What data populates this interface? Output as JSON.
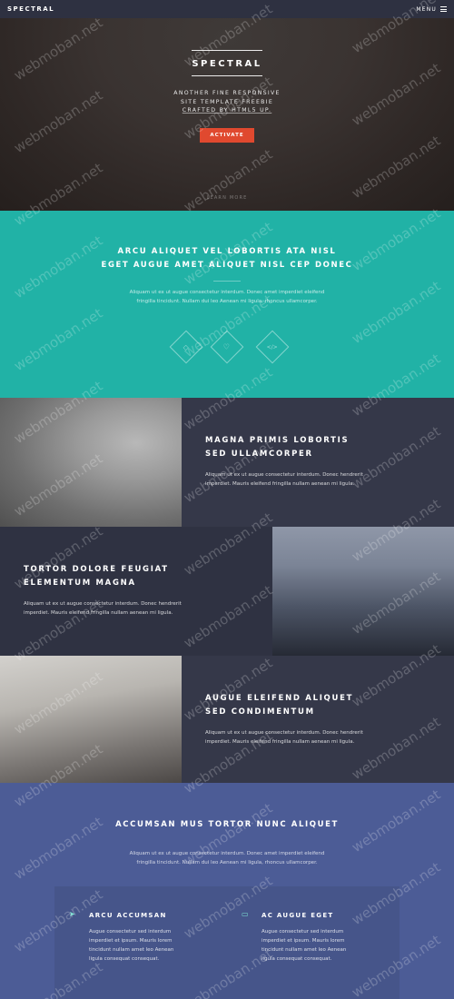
{
  "nav": {
    "logo": "SPECTRAL",
    "menu_label": "MENU",
    "menu_icon": "hamburger-icon"
  },
  "hero": {
    "title": "SPECTRAL",
    "subtitle_lines": [
      "ANOTHER FINE RESPONSIVE",
      "SITE TEMPLATE FREEBIE",
      "CRAFTED BY HTML5 UP."
    ],
    "button": "ACTIVATE",
    "learn_more": "LEARN MORE"
  },
  "intro": {
    "heading_lines": [
      "ARCU ALIQUET VEL LOBORTIS ATA NISL",
      "EGET AUGUE AMET ALIQUET NISL CEP DONEC"
    ],
    "text_lines": [
      "Aliquam ut ex ut augue consectetur interdum. Donec amet imperdiet eleifend",
      "fringilla tincidunt. Nullam dui leo Aenean mi ligula, rhoncus ullamcorper."
    ],
    "icons": [
      "diamond-icon",
      "heart-icon",
      "code-icon"
    ],
    "icon_glyphs": [
      "◇",
      "♡",
      "</>"
    ]
  },
  "spotlights": [
    {
      "heading_lines": [
        "MAGNA PRIMIS LOBORTIS",
        "SED ULLAMCORPER"
      ],
      "text_lines": [
        "Aliquam ut ex ut augue consectetur interdum. Donec hendrerit",
        "imperdiet. Mauris eleifend fringilla nullam aenean mi ligula."
      ]
    },
    {
      "heading_lines": [
        "TORTOR DOLORE FEUGIAT",
        "ELEMENTUM MAGNA"
      ],
      "text_lines": [
        "Aliquam ut ex ut augue consectetur interdum. Donec hendrerit",
        "imperdiet. Mauris eleifend fringilla nullam aenean mi ligula."
      ]
    },
    {
      "heading_lines": [
        "AUGUE ELEIFEND ALIQUET",
        "SED CONDIMENTUM"
      ],
      "text_lines": [
        "Aliquam ut ex ut augue consectetur interdum. Donec hendrerit",
        "imperdiet. Mauris eleifend fringilla nullam aenean mi ligula."
      ]
    }
  ],
  "features": {
    "heading": "ACCUMSAN MUS TORTOR NUNC ALIQUET",
    "text_lines": [
      "Aliquam ut ex ut augue consectetur interdum. Donec amet imperdiet eleifend",
      "fringilla tincidunt. Nullam dui leo Aenean mi ligula, rhoncus ullamcorper."
    ],
    "cards": [
      {
        "icon": "paper-plane-icon",
        "glyph": "➤",
        "title": "ARCU ACCUMSAN",
        "text_lines": [
          "Augue consectetur sed interdum",
          "imperdiet et ipsum. Mauris lorem",
          "tincidunt nullam amet leo Aenean",
          "ligula consequat consequat."
        ]
      },
      {
        "icon": "laptop-icon",
        "glyph": "▭",
        "title": "AC AUGUE EGET",
        "text_lines": [
          "Augue consectetur sed interdum",
          "imperdiet et ipsum. Mauris lorem",
          "tincidunt nullam amet leo Aenean",
          "ligula consequat consequat."
        ]
      }
    ]
  },
  "watermark": "webmoban.net",
  "colors": {
    "teal": "#21b2a6",
    "dark": "#353849",
    "purple": "#4c5c96",
    "accent": "#e0492f",
    "nav": "#2e3141"
  }
}
